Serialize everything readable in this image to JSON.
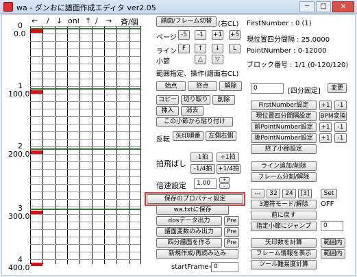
{
  "window": {
    "title": "wa - ダンおに譜面作成エディタ ver2.05",
    "minimize": "─",
    "maximize": "□",
    "close": "✕"
  },
  "grid": {
    "arrows": [
      "←",
      "/",
      "↓",
      "oni",
      "↑",
      "/",
      "→",
      "斉/個"
    ],
    "measures": [
      {
        "num": "0",
        "pos": "0.0"
      },
      {
        "num": "1",
        "pos": "100.0"
      },
      {
        "num": "2",
        "pos": "200.0"
      },
      {
        "num": "3",
        "pos": "300.0"
      },
      {
        "num": "4",
        "pos": "400.0"
      }
    ]
  },
  "controls": {
    "switch_btn": "譜面/フレーム切替",
    "switch_note": "(右CL)",
    "page_label": "ページ",
    "page_btns": [
      "-5",
      "-1",
      "+1",
      "+5"
    ],
    "line_label": "ライン",
    "line_btns": [
      "F",
      "↑",
      "↓",
      "L"
    ],
    "bar_label": "小節",
    "bar_btns": [
      "△",
      "▽"
    ],
    "range_label": "範囲指定、操作(譜面右CL)",
    "start_btn": "始点",
    "end_btn": "終点",
    "clear_btn": "解除",
    "copy_btn": "コピー",
    "cut_btn": "切り取り",
    "delete_btn": "削除",
    "insert_btn": "挿入",
    "erase_btn": "消去",
    "paste_btn": "この小節から貼り付け",
    "reverse_label": "反転",
    "arrow_order_btn": "矢印順番",
    "lr_reverse_btn": "左側右側",
    "beat_label": "拍飛ばし",
    "minus1_btn": "-1拍",
    "plus1_btn": "+1拍",
    "minus_quarter_btn": "-1/4拍",
    "plus_quarter_btn": "+1/4拍",
    "speed_label": "倍速設定",
    "speed_value": "1.00",
    "spin_up": "+",
    "spin_down": "-",
    "save_props_btn": "保存のプロパティ設定",
    "wa_save_btn": "wa.txtに保存",
    "dos_btn": "dosデータ出力",
    "dos_pre": "Pre",
    "vars_btn": "譜面変数のみ出力",
    "vars_pre": "Pre",
    "quarter_btn": "四分譜面を作る",
    "quarter_pre": "Pre",
    "new_btn": "新規作成/再読み込み",
    "start_frame_label": "startFrame=",
    "start_frame_value": "0"
  },
  "info": {
    "first_number": "FirstNumber : 0 (1)",
    "interval": "現位置四分間隔 : 25.0000",
    "point_number": "PointNumber : 0-12000",
    "block": "ブロック番号 : 1/1 (0-120/120)"
  },
  "right": {
    "field_value": "0",
    "fixed_label": "[四分固定]",
    "change_btn": "変更",
    "first_number_btn": "FirstNumber設定",
    "interval_btn": "現位置四分間隔設定",
    "bpm_btn": "BPM変換",
    "prev_point_btn": "前PointNumber設定",
    "next_point_btn": "後PointNumber設定",
    "end_bar_btn": "終了小節設定",
    "plus1": "+1",
    "minus1": "-1",
    "line_add_btn": "ライン追加/削除",
    "frame_split_btn": "フレーム分割/解除",
    "dash_btn": "---",
    "b32_btn": "32",
    "b24_btn": "24",
    "b3_btn": "[3]",
    "set_btn": "Set",
    "triplet_btn": "3連符モード/解除",
    "off_label": "OFF",
    "back_btn": "前に戻す",
    "jump_btn": "指定小節にジャンプ",
    "jump_value": "0",
    "arrow_count_btn": "矢印数を計算",
    "range_in_btn": "範囲内",
    "frame_info_btn": "フレーム情報を表示",
    "range_in_btn2": "範囲内",
    "tool_btn": "ツール難易度計算"
  }
}
